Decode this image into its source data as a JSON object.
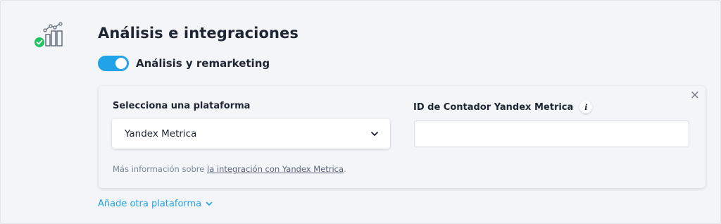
{
  "section": {
    "title": "Análisis e integraciones",
    "icon": "analytics-check-icon"
  },
  "toggle": {
    "label": "Análisis y remarketing",
    "enabled": true,
    "color": "#20a3e8"
  },
  "card": {
    "platform_label": "Selecciona una plataforma",
    "platform_selected": "Yandex Metrica",
    "id_label": "ID de Contador Yandex Metrica",
    "info_glyph": "i",
    "id_value": "",
    "close_glyph": "×",
    "help_prefix": "Más información sobre ",
    "help_link": "la integración con Yandex Metrica",
    "help_suffix": "."
  },
  "add_platform": {
    "label": "Añade otra plataforma"
  },
  "colors": {
    "accent": "#20a3e8",
    "success": "#22c35e",
    "text": "#1f2633",
    "muted": "#7a8496"
  }
}
